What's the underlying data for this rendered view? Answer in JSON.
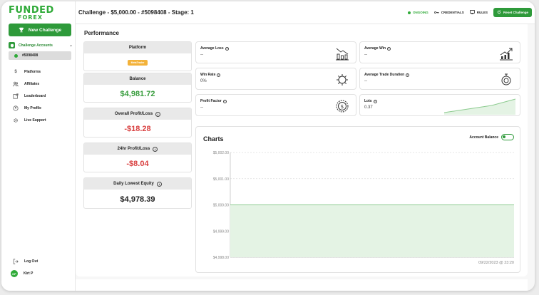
{
  "brand": {
    "line1": "FUNDED",
    "line2": "FOREX",
    "color": "#2faa38"
  },
  "sidebar": {
    "new_challenge": "New Challenge",
    "accounts_label": "Challenge Accounts",
    "account_id": "#5098408",
    "items": [
      {
        "label": "Platforms",
        "icon": "dollar-icon"
      },
      {
        "label": "Affiliates",
        "icon": "people-icon"
      },
      {
        "label": "Leaderboard",
        "icon": "external-link-icon"
      },
      {
        "label": "My Profile",
        "icon": "user-icon"
      },
      {
        "label": "Live Support",
        "icon": "gear-icon"
      }
    ],
    "logout": "Log Out",
    "user_initials": "KP",
    "user_name": "Kirt P"
  },
  "header": {
    "title": "Challenge - $5,000.00 - #5098408 - Stage: 1",
    "status": "ONGOING",
    "credentials": "CREDENTIALS",
    "rules": "RULES",
    "reset": "Reset Challenge"
  },
  "performance": {
    "heading": "Performance",
    "platform_label": "Platform",
    "platform_value": "MetaTrader",
    "balance_label": "Balance",
    "balance_value": "$4,981.72",
    "overall_pl_label": "Overall Profit/Loss",
    "overall_pl_value": "-$18.28",
    "daily_pl_label": "24hr Profit/Loss",
    "daily_pl_value": "-$8.04",
    "lowest_equity_label": "Daily Lowest Equity",
    "lowest_equity_value": "$4,978.39"
  },
  "metrics": {
    "avg_loss_label": "Average Loss",
    "avg_loss_value": "--",
    "avg_win_label": "Average Win",
    "avg_win_value": "--",
    "win_rate_label": "Win Rate",
    "win_rate_value": "0%",
    "avg_duration_label": "Average Trade Duration",
    "avg_duration_value": "--",
    "profit_factor_label": "Profit Factor",
    "profit_factor_value": "--",
    "lots_label": "Lots",
    "lots_value": "0.37",
    "lots_trend": [
      0.05,
      0.3,
      0.55,
      1.0
    ]
  },
  "charts": {
    "title": "Charts",
    "toggle_label": "Account Balance",
    "toggle_on": true
  },
  "chart_data": {
    "type": "area",
    "title": "",
    "xlabel": "",
    "ylabel": "",
    "yticks": [
      "$5,002.00",
      "$5,001.00",
      "$5,000.00",
      "$4,999.00",
      "$4,998.00"
    ],
    "ylim": [
      4998,
      5002
    ],
    "x_label_text": "09/22/2023 @ 23:20",
    "series": [
      {
        "values": [
          5000,
          5000
        ]
      }
    ],
    "grid": true,
    "line_color": "#8ccb8f",
    "fill_color": "#e4f3e4"
  }
}
